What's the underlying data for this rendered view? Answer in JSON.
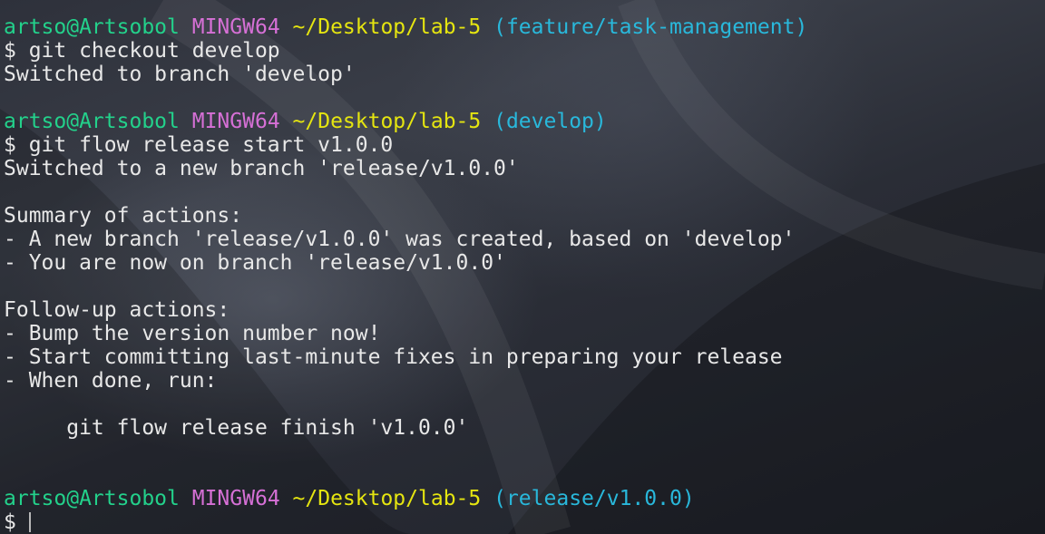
{
  "prompt1": {
    "user": "artso@Artsobol",
    "system": "MINGW64",
    "path": "~/Desktop/lab-5",
    "branch": "(feature/task-management)"
  },
  "cmd1": "$ git checkout develop",
  "out1": "Switched to branch 'develop'",
  "prompt2": {
    "user": "artso@Artsobol",
    "system": "MINGW64",
    "path": "~/Desktop/lab-5",
    "branch": "(develop)"
  },
  "cmd2": "$ git flow release start v1.0.0",
  "out2": [
    "Switched to a new branch 'release/v1.0.0'",
    "",
    "Summary of actions:",
    "- A new branch 'release/v1.0.0' was created, based on 'develop'",
    "- You are now on branch 'release/v1.0.0'",
    "",
    "Follow-up actions:",
    "- Bump the version number now!",
    "- Start committing last-minute fixes in preparing your release",
    "- When done, run:",
    "",
    "     git flow release finish 'v1.0.0'",
    "",
    ""
  ],
  "prompt3": {
    "user": "artso@Artsobol",
    "system": "MINGW64",
    "path": "~/Desktop/lab-5",
    "branch": "(release/v1.0.0)"
  },
  "cmd3": "$",
  "colors": {
    "user": "#23d18b",
    "system": "#d670d6",
    "path": "#e5e510",
    "branch": "#29b8db",
    "text": "#e8e8e8"
  }
}
